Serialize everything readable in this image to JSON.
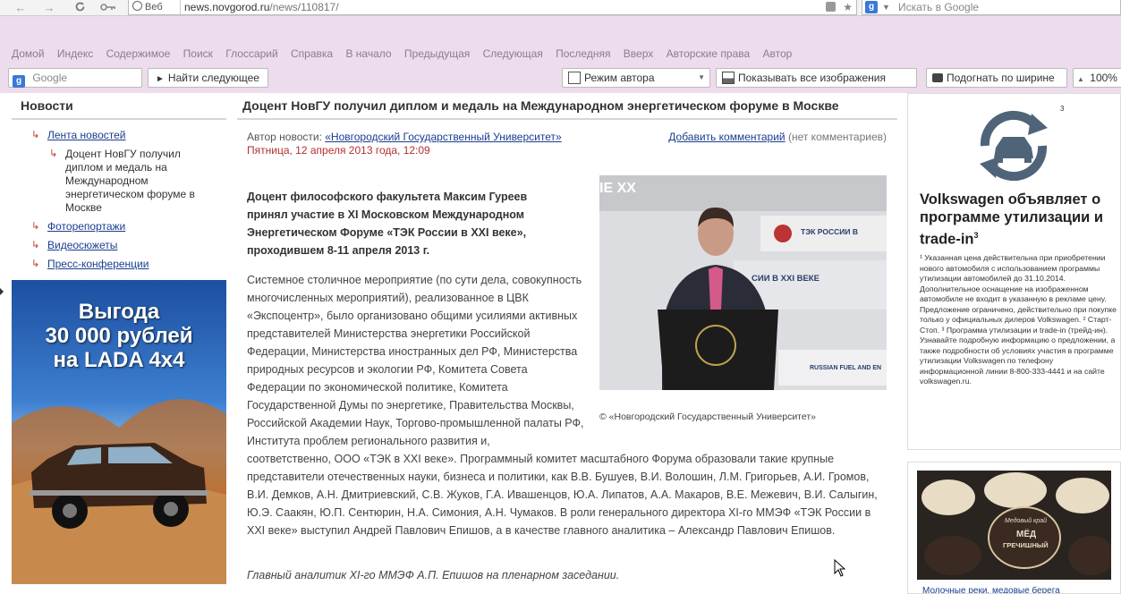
{
  "browser": {
    "web_tab": "Веб",
    "url_host": "news.novgorod.ru",
    "url_path": "/news/110817/",
    "search_placeholder": "Искать в Google"
  },
  "site_nav": [
    "Домой",
    "Индекс",
    "Содержимое",
    "Поиск",
    "Глоссарий",
    "Справка",
    "В начало",
    "Предыдущая",
    "Следующая",
    "Последняя",
    "Вверх",
    "Авторские права",
    "Автор"
  ],
  "toolbar": {
    "google_placeholder": "Google",
    "find_next": "Найти следующее",
    "author_mode": "Режим автора",
    "show_images": "Показывать все изображения",
    "fit_width": "Подогнать по ширине",
    "zoom": "100%"
  },
  "sidebar": {
    "title": "Новости",
    "items": [
      {
        "label": "Лента новостей"
      },
      {
        "label": "Доцент НовГУ получил диплом и медаль на Международном энергетическом форуме в Москве"
      },
      {
        "label": "Фоторепортажи"
      },
      {
        "label": "Видеосюжеты"
      },
      {
        "label": "Пресс-конференции"
      }
    ]
  },
  "ad_lada": {
    "line1": "Выгода",
    "line2": "30 000 рублей",
    "line3": "на LADA 4x4"
  },
  "article": {
    "title": "Доцент НовГУ получил диплом и медаль на Международном энергетическом форуме в Москве",
    "author_label": "Автор новости:",
    "author": "«Новгородский Государственный Университет»",
    "add_comment": "Добавить комментарий",
    "no_comments": "(нет комментариев)",
    "date": "Пятница, 12 апреля 2013 года, 12:09",
    "lead": "Доцент философского факультета Максим Гуреев принял участие в XI Московском Международном Энергетическом Форуме «ТЭК России в XXI веке», проходившем 8-11 апреля 2013 г.",
    "body_part1": "Системное столичное мероприятие (по сути дела, совокупность многочисленных мероприятий), реализованное в ЦВК «Экспоцентр», было организовано общими усилиями активных представителей Министерства энергетики Российской Федерации, Министерства иностранных дел РФ, Министерства природных ресурсов и экологии РФ, Комитета Совета Федерации по экономической политике, Комитета Государственной Думы по энергетике, Правительства Москвы, Российской Академии Наук, Торгово-промышленной палаты РФ, Института проблем регионального развития и,",
    "body_part2": "соответственно, ООО «ТЭК в XXI веке». Программный комитет масштабного Форума образовали такие крупные представители отечественных науки, бизнеса и политики, как В.В. Бушуев, В.И. Волошин, Л.М. Григорьев, А.И. Громов, В.И. Демков, А.Н. Дмитриевский, С.В. Жуков, Г.А. Ивашенцов, Ю.А. Липатов, А.А. Макаров, В.Е. Межевич, В.И. Салыгин, Ю.Э. Саакян, Ю.П. Сентюрин, Н.А. Симония, А.Н. Чумаков. В роли генерального директора XI-го ММЭФ «ТЭК России в XXI веке» выступил Андрей Павлович Епишов, а в качестве главного аналитика – Александр Павлович Епишов.",
    "photo_caption": "© «Новгородский Государственный Университет»",
    "photo_banner_1": "ТЭК РОССИИ В",
    "photo_banner_2": "СИИ В XXI ВЕКЕ",
    "photo_banner_3": "RUSSIAN FUEL AND EN",
    "photo_top": "IE XX",
    "italic_caption": "Главный аналитик XI-го ММЭФ А.П. Епишов на пленарном заседании."
  },
  "ad_vw": {
    "superscript": "3",
    "title": "Volkswagen объявляет о программе утилизации и trade-in",
    "title_sup": "3",
    "fine_print": "¹ Указанная цена действительна при приобретении нового автомобиля с использованием программы утилизации автомобилей до 31.10.2014. Дополнительное оснащение на изображенном автомобиле не входит в указанную в рекламе цену. Предложение ограничено, действительно при покупке только у официальных дилеров Volkswagen. ² Старт-Стоп. ³ Программа утилизации и trade-in (трейд-ин). Узнавайте подробную информацию о предложении, а также подробности об условиях участия в программе утилизации Volkswagen по телефону информационной линии 8-800-333-4441 и на сайте volkswagen.ru."
  },
  "ad_honey": {
    "jar_text_1": "Медовый край",
    "jar_text_2": "МЁД",
    "jar_text_3": "ГРЕЧИШНЫЙ",
    "bottom_link": "Молочные реки, медовые берега"
  }
}
